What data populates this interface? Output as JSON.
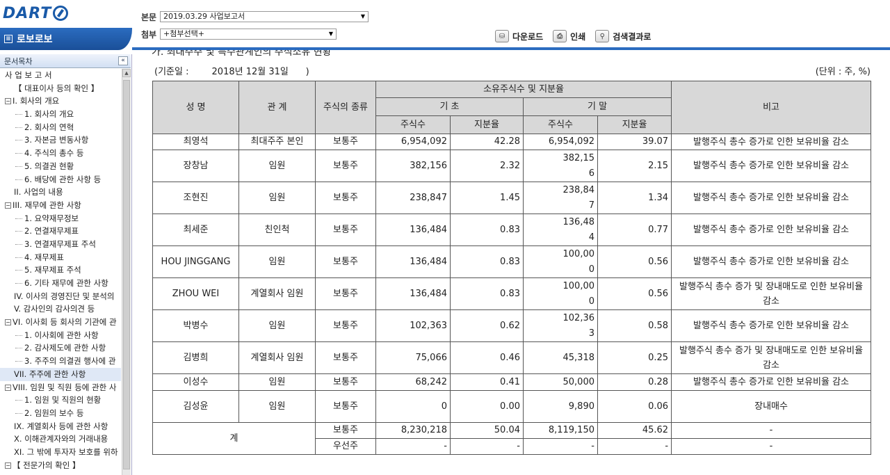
{
  "header": {
    "logo_text": "DART",
    "company_name": "로보로보",
    "company_icon": "doc-icon",
    "main_label": "본문",
    "main_value": "2019.03.29   사업보고서",
    "attach_label": "첨부",
    "attach_value": "+첨부선택+",
    "toolbar": [
      {
        "label": "다운로드",
        "icon": "download-icon"
      },
      {
        "label": "인쇄",
        "icon": "print-icon"
      },
      {
        "label": "검색결과로",
        "icon": "search-icon"
      }
    ]
  },
  "sidebar": {
    "title": "문서목차",
    "collapse_glyph": "«",
    "items": [
      {
        "label": "사 업 보 고 서",
        "level": 1
      },
      {
        "label": "【 대표이사 등의 확인 】",
        "level": 0
      },
      {
        "label": "I. 회사의 개요",
        "level": 1,
        "box": "−"
      },
      {
        "label": "1. 회사의 개요",
        "level": 2
      },
      {
        "label": "2. 회사의 연혁",
        "level": 2
      },
      {
        "label": "3. 자본금 변동사항",
        "level": 2
      },
      {
        "label": "4. 주식의 총수 등",
        "level": 2
      },
      {
        "label": "5. 의결권 현황",
        "level": 2
      },
      {
        "label": "6. 배당에 관한 사항 등",
        "level": 2
      },
      {
        "label": "II. 사업의 내용",
        "level": 0
      },
      {
        "label": "III. 재무에 관한 사항",
        "level": 1,
        "box": "−"
      },
      {
        "label": "1. 요약재무정보",
        "level": 2
      },
      {
        "label": "2. 연결재무제표",
        "level": 2
      },
      {
        "label": "3. 연결재무제표 주석",
        "level": 2
      },
      {
        "label": "4. 재무제표",
        "level": 2
      },
      {
        "label": "5. 재무제표 주석",
        "level": 2
      },
      {
        "label": "6. 기타 재무에 관한 사항",
        "level": 2
      },
      {
        "label": "IV. 이사의 경영진단 및 분석의",
        "level": 0
      },
      {
        "label": "V. 감사인의 감사의견 등",
        "level": 0
      },
      {
        "label": "VI. 이사회 등 회사의 기관에 관",
        "level": 1,
        "box": "−"
      },
      {
        "label": "1. 이사회에 관한 사항",
        "level": 2
      },
      {
        "label": "2. 감사제도에 관한 사항",
        "level": 2
      },
      {
        "label": "3. 주주의 의결권 행사에 관",
        "level": 2
      },
      {
        "label": "VII. 주주에 관한 사항",
        "level": 0,
        "active": true
      },
      {
        "label": "VIII. 임원 및 직원 등에 관한 사",
        "level": 1,
        "box": "−"
      },
      {
        "label": "1. 임원 및 직원의 현황",
        "level": 2
      },
      {
        "label": "2. 임원의 보수 등",
        "level": 2
      },
      {
        "label": "IX. 계열회사 등에 관한 사항",
        "level": 0
      },
      {
        "label": "X. 이해관계자와의 거래내용",
        "level": 0
      },
      {
        "label": "XI. 그 밖에 투자자 보호를 위하",
        "level": 0
      },
      {
        "label": "【 전문가의 확인 】",
        "level": 1,
        "box": "−"
      }
    ]
  },
  "main": {
    "cut_heading": "가. 최대주주 및 특수관계인의 주식소유 현황",
    "base_date": "(기준일 :        2018년 12월 31일      )",
    "unit": "(단위 : 주, %)",
    "headers": {
      "name": "성 명",
      "relation": "관 계",
      "stock_type": "주식의 종류",
      "holdings": "소유주식수 및 지분율",
      "begin": "기 초",
      "end": "기 말",
      "shares": "주식수",
      "ratio": "지분율",
      "note": "비고"
    },
    "rows": [
      {
        "name": "최영석",
        "relation": "최대주주 본인",
        "type": "보통주",
        "b_shares": "6,954,092",
        "b_ratio": "42.28",
        "e_shares": "6,954,092",
        "e_ratio": "39.07",
        "note": "발행주식 총수 증가로 인한 보유비율 감소"
      },
      {
        "name": "장창남",
        "relation": "임원",
        "type": "보통주",
        "b_shares": "382,156",
        "b_ratio": "2.32",
        "e_shares": "382,156",
        "e_ratio": "2.15",
        "note": "발행주식 총수 증가로 인한 보유비율 감소"
      },
      {
        "name": "조현진",
        "relation": "임원",
        "type": "보통주",
        "b_shares": "238,847",
        "b_ratio": "1.45",
        "e_shares": "238,847",
        "e_ratio": "1.34",
        "note": "발행주식 총수 증가로 인한 보유비율 감소"
      },
      {
        "name": "최세준",
        "relation": "친인척",
        "type": "보통주",
        "b_shares": "136,484",
        "b_ratio": "0.83",
        "e_shares": "136,484",
        "e_ratio": "0.77",
        "note": "발행주식 총수 증가로 인한 보유비율 감소"
      },
      {
        "name": "HOU JINGGANG",
        "relation": "임원",
        "type": "보통주",
        "b_shares": "136,484",
        "b_ratio": "0.83",
        "e_shares": "100,000",
        "e_ratio": "0.56",
        "note": "발행주식 총수 증가로 인한 보유비율 감소"
      },
      {
        "name": "ZHOU WEI",
        "relation": "계열회사 임원",
        "type": "보통주",
        "b_shares": "136,484",
        "b_ratio": "0.83",
        "e_shares": "100,000",
        "e_ratio": "0.56",
        "note": "발행주식 총수 증가 및 장내매도로 인한 보유비율 감소"
      },
      {
        "name": "박병수",
        "relation": "임원",
        "type": "보통주",
        "b_shares": "102,363",
        "b_ratio": "0.62",
        "e_shares": "102,363",
        "e_ratio": "0.58",
        "note": "발행주식 총수 증가로 인한 보유비율 감소"
      },
      {
        "name": "김병희",
        "relation": "계열회사 임원",
        "type": "보통주",
        "b_shares": "75,066",
        "b_ratio": "0.46",
        "e_shares": "45,318",
        "e_ratio": "0.25",
        "note": "발행주식 총수 증가 및 장내매도로 인한 보유비율 감소"
      },
      {
        "name": "이성수",
        "relation": "임원",
        "type": "보통주",
        "b_shares": "68,242",
        "b_ratio": "0.41",
        "e_shares": "50,000",
        "e_ratio": "0.28",
        "note": "발행주식 총수 증가로 인한 보유비율 감소"
      },
      {
        "name": "김성윤",
        "relation": "임원",
        "type": "보통주",
        "b_shares": "0",
        "b_ratio": "0.00",
        "e_shares": "9,890",
        "e_ratio": "0.06",
        "note": "장내매수"
      }
    ],
    "total_label": "계",
    "totals": [
      {
        "type": "보통주",
        "b_shares": "8,230,218",
        "b_ratio": "50.04",
        "e_shares": "8,119,150",
        "e_ratio": "45.62",
        "note": "-"
      },
      {
        "type": "우선주",
        "b_shares": "-",
        "b_ratio": "-",
        "e_shares": "-",
        "e_ratio": "-",
        "note": "-"
      }
    ]
  }
}
